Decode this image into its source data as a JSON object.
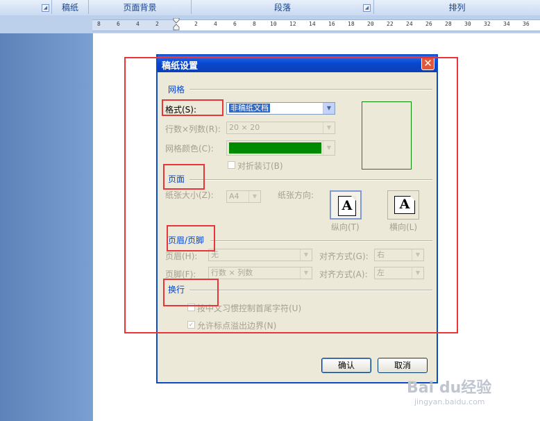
{
  "ribbon": {
    "groups": [
      "稿纸",
      "页面背景",
      "段落",
      "排列"
    ]
  },
  "ruler": {
    "ticks": [
      "8",
      "6",
      "4",
      "2",
      "2",
      "4",
      "6",
      "8",
      "10",
      "12",
      "14",
      "16",
      "18",
      "20",
      "22",
      "24",
      "26",
      "28",
      "30",
      "32",
      "34",
      "36"
    ]
  },
  "dialog": {
    "title": "稿纸设置",
    "close": "✕",
    "grid_section": "网格",
    "format_label": "格式(S):",
    "format_value": "非稿纸文档",
    "rows_cols_label": "行数×列数(R):",
    "rows_cols_value": "20 × 20",
    "grid_color_label": "网格颜色(C):",
    "grid_color_value": "#008a00",
    "fold_label": "对折装订(B)",
    "page_section": "页面",
    "paper_size_label": "纸张大小(Z):",
    "paper_size_value": "A4",
    "orientation_label": "纸张方向:",
    "portrait_label": "纵向(T)",
    "landscape_label": "横向(L)",
    "header_footer_section": "页眉/页脚",
    "header_label": "页眉(H):",
    "header_value": "无",
    "header_align_label": "对齐方式(G):",
    "header_align_value": "右",
    "footer_label": "页脚(F):",
    "footer_value": "行数 × 列数",
    "footer_align_label": "对齐方式(A):",
    "footer_align_value": "左",
    "wrap_section": "换行",
    "opt_chinese_label": "按中文习惯控制首尾字符(U)",
    "opt_punct_label": "允许标点溢出边界(N)",
    "ok_label": "确认",
    "cancel_label": "取消",
    "accent_color": "#0a4cc6"
  },
  "watermark": {
    "brand": "Bai du经验",
    "url": "jingyan.baidu.com"
  }
}
